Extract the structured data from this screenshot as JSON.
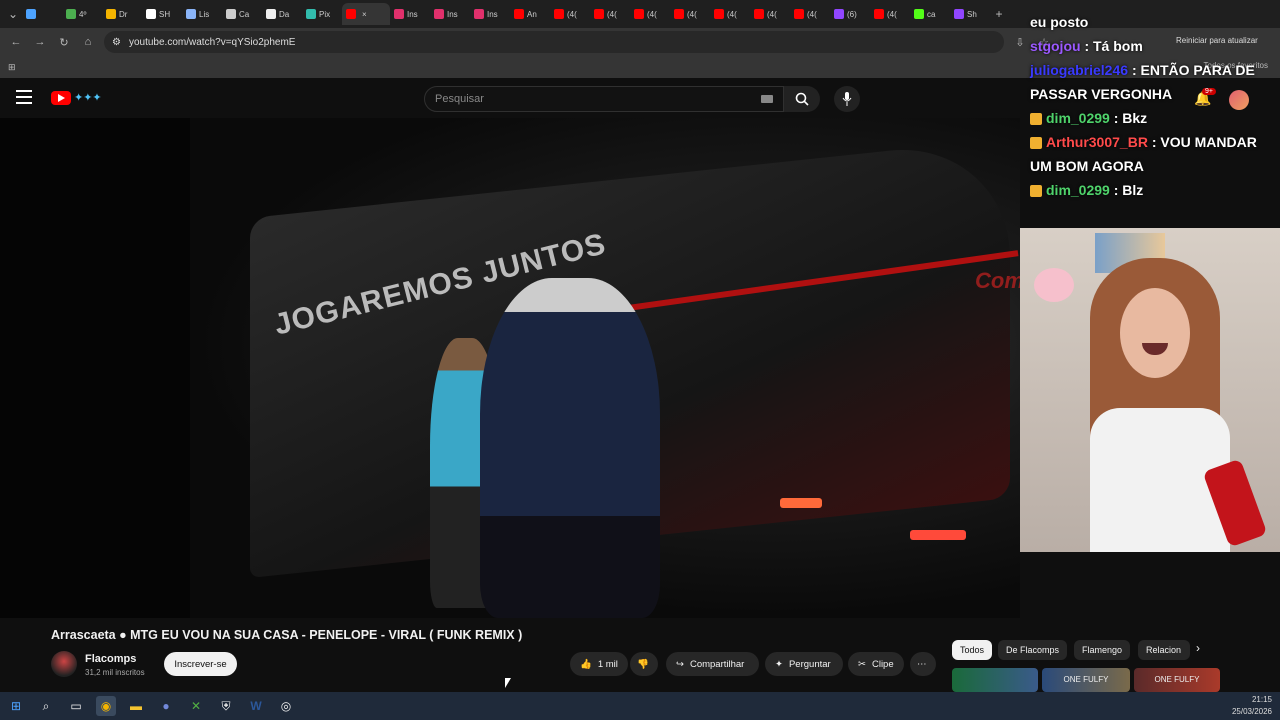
{
  "browser": {
    "tabs": [
      {
        "label": "",
        "color": "#4da3ff"
      },
      {
        "label": "4º",
        "color": "#4caf50"
      },
      {
        "label": "Dr",
        "color": "#f4b400"
      },
      {
        "label": "SH",
        "color": "#ffffff"
      },
      {
        "label": "Lis",
        "color": "#8ab4f8"
      },
      {
        "label": "Ca",
        "color": "#cccccc"
      },
      {
        "label": "Da",
        "color": "#eeeeee"
      },
      {
        "label": "Pix",
        "color": "#32bcad"
      },
      {
        "label": "",
        "color": "#ff0000"
      },
      {
        "label": "Ins",
        "color": "#e1306c"
      },
      {
        "label": "Ins",
        "color": "#e1306c"
      },
      {
        "label": "Ins",
        "color": "#e1306c"
      },
      {
        "label": "An",
        "color": "#ff0000"
      },
      {
        "label": "(4(",
        "color": "#ff0000"
      },
      {
        "label": "(4(",
        "color": "#ff0000"
      },
      {
        "label": "(4(",
        "color": "#ff0000"
      },
      {
        "label": "(4(",
        "color": "#ff0000"
      },
      {
        "label": "(4(",
        "color": "#ff0000"
      },
      {
        "label": "(4(",
        "color": "#ff0000"
      },
      {
        "label": "(4(",
        "color": "#ff0000"
      },
      {
        "label": "(6)",
        "color": "#9146ff"
      },
      {
        "label": "(4(",
        "color": "#ff0000"
      },
      {
        "label": "ca",
        "color": "#53fc18"
      },
      {
        "label": "Sh",
        "color": "#9146ff"
      }
    ],
    "url": "youtube.com/watch?v=qYSio2phemE",
    "restart_label": "Reiniciar para atualizar",
    "bookmarks_label": "Todos os favoritos"
  },
  "youtube": {
    "search_placeholder": "Pesquisar",
    "notif_count": "9+",
    "video_title": "Arrascaeta ● MTG EU VOU NA SUA CASA - PENELOPE - VIRAL ( FUNK REMIX )",
    "channel_name": "Flacomps",
    "channel_subs": "31,2 mil inscritos",
    "subscribe_label": "Inscrever-se",
    "like_count": "1 mil",
    "share_label": "Compartilhar",
    "ask_label": "Perguntar",
    "clip_label": "Clipe",
    "chips": [
      "Todos",
      "De Flacomps",
      "Flamengo",
      "Relacion"
    ],
    "thumbs": [
      "",
      "ONE FULFY",
      "ONE FULFY"
    ],
    "video_text": "JOGAREMOS JUNTOS",
    "video_overlay_logo": "Compa"
  },
  "chat": {
    "messages": [
      {
        "user": "",
        "text": "eu posto",
        "color": "#ffffff"
      },
      {
        "user": "stgojou",
        "text": ": Tá bom",
        "color": "#9b59ff"
      },
      {
        "user": "juliogabriel246",
        "text": ": ENTÃO PARA DE PASSAR VERGONHA",
        "color": "#3a3aff"
      },
      {
        "user": "dim_0299",
        "text": ": Bkz",
        "color": "#4fd36b"
      },
      {
        "user": "Arthur3007_BR",
        "text": ": VOU MANDAR UM BOM AGORA",
        "color": "#ff4b4b"
      },
      {
        "user": "dim_0299",
        "text": ": Blz",
        "color": "#4fd36b"
      }
    ]
  },
  "taskbar": {
    "time": "21:15",
    "date": "25/03/2026"
  }
}
